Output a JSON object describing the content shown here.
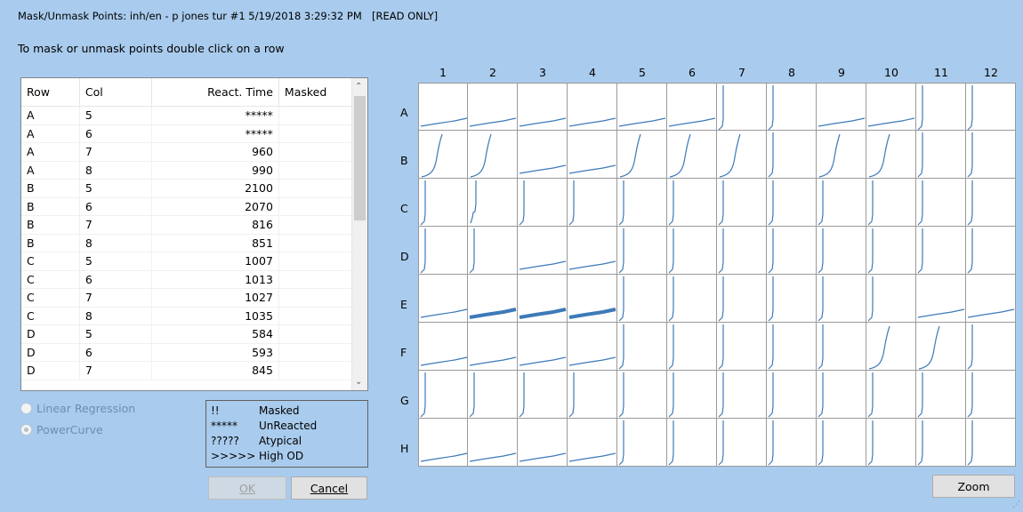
{
  "window": {
    "title": "Mask/Unmask Points: inh/en - p jones tur #1 5/19/2018 3:29:32 PM",
    "read_only": "[READ ONLY]"
  },
  "instruction": "To mask or unmask points double click on a row",
  "table": {
    "headers": [
      "Row",
      "Col",
      "React. Time",
      "Masked"
    ],
    "rows": [
      [
        "A",
        "5",
        "*****",
        ""
      ],
      [
        "A",
        "6",
        "*****",
        ""
      ],
      [
        "A",
        "7",
        "960",
        ""
      ],
      [
        "A",
        "8",
        "990",
        ""
      ],
      [
        "B",
        "5",
        "2100",
        ""
      ],
      [
        "B",
        "6",
        "2070",
        ""
      ],
      [
        "B",
        "7",
        "816",
        ""
      ],
      [
        "B",
        "8",
        "851",
        ""
      ],
      [
        "C",
        "5",
        "1007",
        ""
      ],
      [
        "C",
        "6",
        "1013",
        ""
      ],
      [
        "C",
        "7",
        "1027",
        ""
      ],
      [
        "C",
        "8",
        "1035",
        ""
      ],
      [
        "D",
        "5",
        "584",
        ""
      ],
      [
        "D",
        "6",
        "593",
        ""
      ],
      [
        "D",
        "7",
        "845",
        ""
      ]
    ]
  },
  "options": {
    "linear_regression": "Linear Regression",
    "power_curve": "PowerCurve",
    "selected": "PowerCurve"
  },
  "legend": [
    {
      "symbol": "!!",
      "meaning": "Masked"
    },
    {
      "symbol": "*****",
      "meaning": "UnReacted"
    },
    {
      "symbol": "?????",
      "meaning": "Atypical"
    },
    {
      "symbol": ">>>>>",
      "meaning": "High OD"
    }
  ],
  "buttons": {
    "ok": "OK",
    "cancel": "Cancel",
    "zoom": "Zoom"
  },
  "plate": {
    "columns": [
      "1",
      "2",
      "3",
      "4",
      "5",
      "6",
      "7",
      "8",
      "9",
      "10",
      "11",
      "12"
    ],
    "rows": [
      "A",
      "B",
      "C",
      "D",
      "E",
      "F",
      "G",
      "H"
    ],
    "curve_color": "#3d7ab8",
    "curve_types": [
      [
        "L",
        "L",
        "L",
        "L",
        "L",
        "L",
        "S",
        "S",
        "L",
        "L",
        "S",
        "S"
      ],
      [
        "E",
        "E",
        "L",
        "L",
        "E",
        "E",
        "E",
        "S",
        "E",
        "E",
        "S",
        "S"
      ],
      [
        "S",
        "K",
        "S",
        "S",
        "S",
        "S",
        "S",
        "S",
        "S",
        "S",
        "S",
        "S"
      ],
      [
        "S",
        "S",
        "L",
        "L",
        "S",
        "S",
        "S",
        "S",
        "S",
        "S",
        "S",
        "S"
      ],
      [
        "L",
        "T",
        "T",
        "T",
        "S",
        "S",
        "S",
        "S",
        "S",
        "S",
        "L",
        "L"
      ],
      [
        "L",
        "L",
        "L",
        "L",
        "S",
        "S",
        "S",
        "S",
        "S",
        "E",
        "E",
        "S"
      ],
      [
        "S",
        "S",
        "S",
        "S",
        "S",
        "S",
        "S",
        "S",
        "S",
        "S",
        "S",
        "S"
      ],
      [
        "L",
        "L",
        "L",
        "L",
        "S",
        "S",
        "S",
        "S",
        "S",
        "S",
        "S",
        "S"
      ]
    ]
  }
}
